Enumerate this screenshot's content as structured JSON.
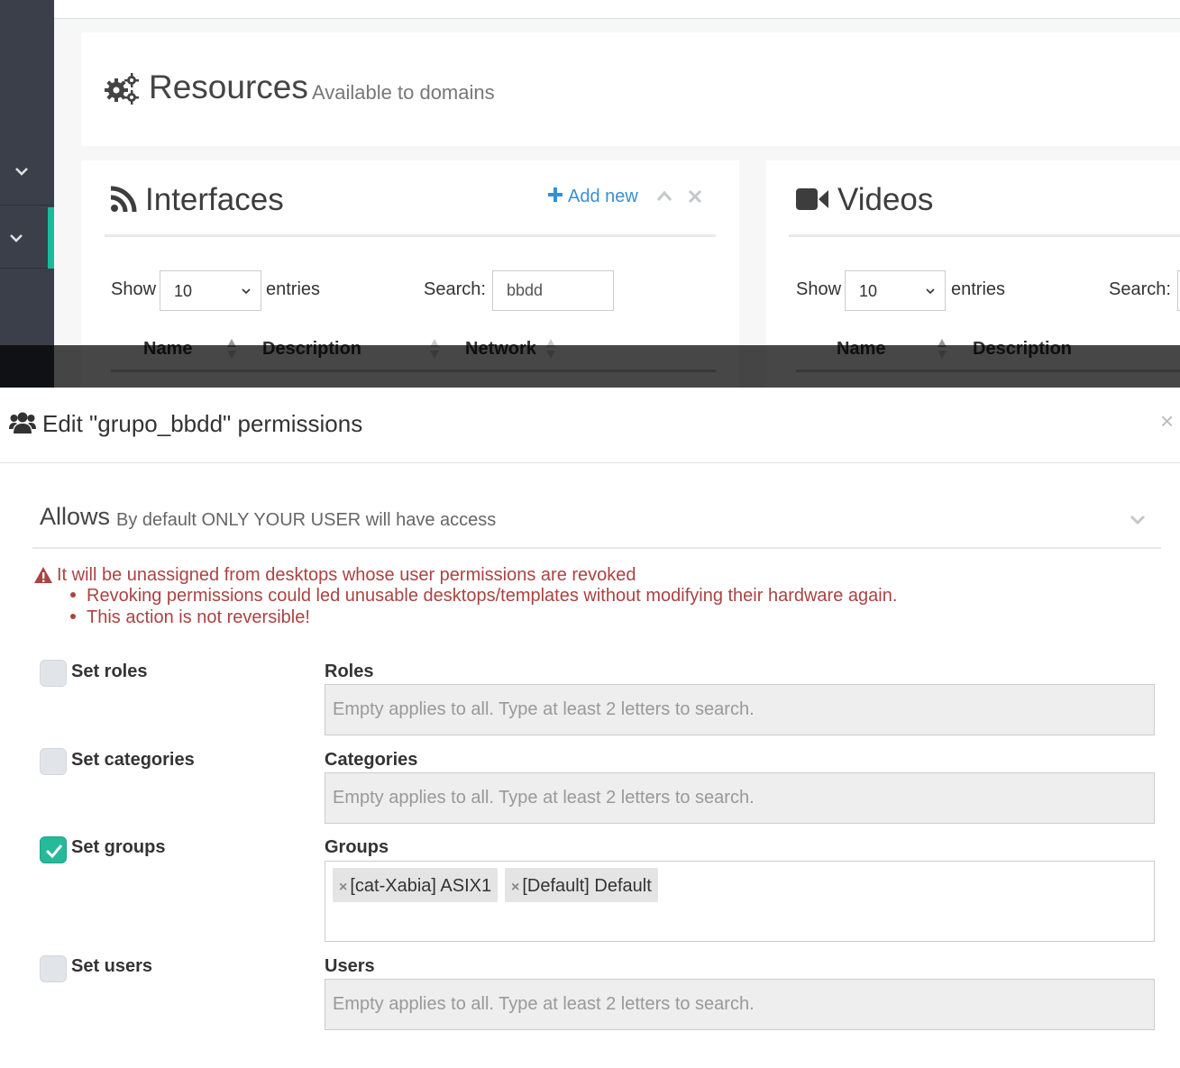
{
  "sidebar": {
    "items": [
      {
        "icon": "chevron-down-icon"
      },
      {
        "icon": "chevron-down-icon",
        "active": true
      }
    ],
    "accent_color": "#1abb9c"
  },
  "page": {
    "title": "Resources",
    "subtitle": "Available to domains",
    "title_icon": "cogs-icon"
  },
  "interfaces_panel": {
    "title": "Interfaces",
    "icon": "rss-icon",
    "add_new_label": "Add new",
    "show_label": "Show",
    "entries_value": "10",
    "entries_label": "entries",
    "search_label": "Search:",
    "search_value": "bbdd",
    "columns": [
      "Name",
      "Description",
      "Network"
    ]
  },
  "videos_panel": {
    "title": "Videos",
    "icon": "video-camera-icon",
    "show_label": "Show",
    "entries_value": "10",
    "entries_label": "entries",
    "search_label": "Search:",
    "columns": [
      "Name",
      "Description"
    ]
  },
  "modal": {
    "title": "Edit \"grupo_bbdd\" permissions",
    "icon": "users-icon",
    "close_label": "×",
    "allows_title": "Allows",
    "allows_subtitle": "By default ONLY YOUR USER will have access",
    "warning_main": "It will be unassigned from desktops whose user permissions are revoked",
    "warning_items": [
      "Revoking permissions could led unusable desktops/templates without modifying their hardware again.",
      "This action is not reversible!"
    ],
    "fields": [
      {
        "checkbox_label": "Set roles",
        "checked": false,
        "field_label": "Roles",
        "placeholder": "Empty applies to all. Type at least 2 letters to search."
      },
      {
        "checkbox_label": "Set categories",
        "checked": false,
        "field_label": "Categories",
        "placeholder": "Empty applies to all. Type at least 2 letters to search."
      },
      {
        "checkbox_label": "Set groups",
        "checked": true,
        "field_label": "Groups",
        "tags": [
          "[cat-Xabia] ASIX1",
          "[Default] Default"
        ]
      },
      {
        "checkbox_label": "Set users",
        "checked": false,
        "field_label": "Users",
        "placeholder": "Empty applies to all. Type at least 2 letters to search."
      }
    ],
    "tag_remove_label": "×",
    "colors": {
      "warning": "#a94442",
      "checked": "#26b99a",
      "link": "#3a8fcf"
    }
  }
}
